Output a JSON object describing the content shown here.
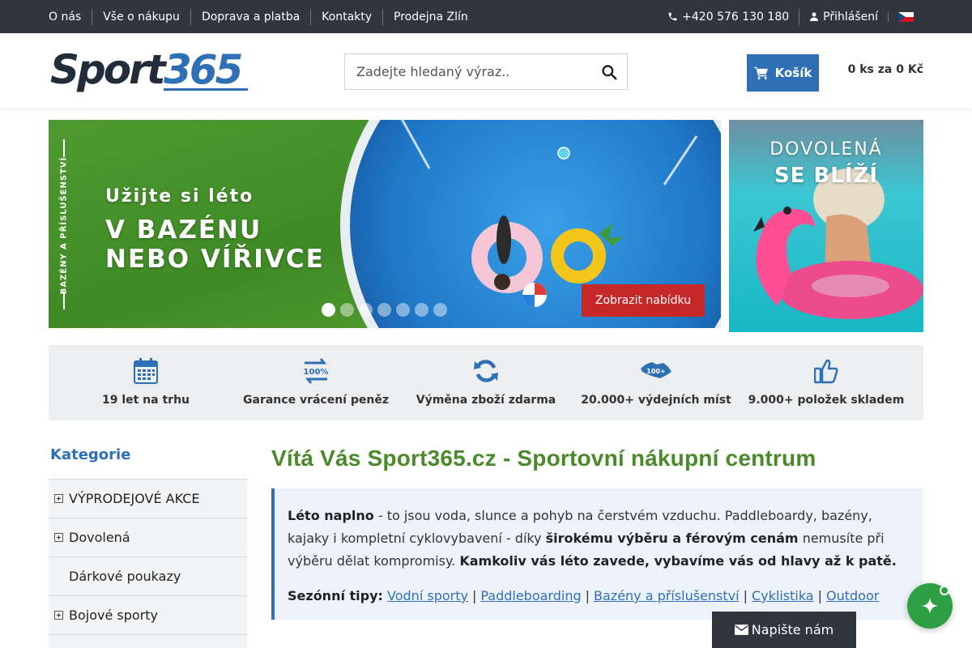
{
  "topbar": {
    "nav": [
      "O nás",
      "Vše o nákupu",
      "Doprava a platba",
      "Kontakty",
      "Prodejna Zlín"
    ],
    "phone": "+420 576 130 180",
    "login": "Přihlášení",
    "language": "cs-flag-icon"
  },
  "header": {
    "logo": {
      "part1": "Sport",
      "part2": "365"
    },
    "search_placeholder": "Zadejte hledaný výraz..",
    "search_value": "",
    "cart_label": "Košík",
    "cart_summary": "0 ks za 0 Kč"
  },
  "hero": {
    "side_label": "BAZÉNY A PŘÍSLUŠENSTVÍ",
    "line1": "Užijte si léto",
    "line2": "V BAZÉNU",
    "line3": "NEBO VÍŘIVCE",
    "cta": "Zobrazit nabídku",
    "slides_total": 7,
    "slide_active": 1
  },
  "promo": {
    "line1": "DOVOLENÁ",
    "line2": "SE BLÍŽÍ"
  },
  "usp": [
    {
      "icon": "calendar-icon",
      "label": "19 let na trhu"
    },
    {
      "icon": "money-back-icon",
      "label": "Garance vrácení peněz"
    },
    {
      "icon": "exchange-icon",
      "label": "Výměna zboží zdarma"
    },
    {
      "icon": "map-cz-icon",
      "label": "20.000+ výdejních míst"
    },
    {
      "icon": "thumbs-up-icon",
      "label": "9.000+ položek skladem"
    }
  ],
  "sidebar": {
    "title": "Kategorie",
    "items": [
      {
        "label": "VÝPRODEJOVÉ AKCE",
        "expandable": true
      },
      {
        "label": "Dovolená",
        "expandable": true
      },
      {
        "label": "Dárkové poukazy",
        "expandable": false
      },
      {
        "label": "Bojové sporty",
        "expandable": true
      }
    ]
  },
  "main": {
    "title": "Vítá Vás Sport365.cz - Sportovní nákupní centrum",
    "intro_b1": "Léto naplno",
    "intro_t1": " - to jsou voda, slunce a pohyb na čerstvém vzduchu. Paddleboardy, bazény, kajaky i kompletní cyklovybavení - díky ",
    "intro_b2": "širokému výběru a férovým cenám",
    "intro_t2": " nemusíte při výběru dělat kompromisy. ",
    "intro_b3": "Kamkoliv vás léto zavede, vybavíme vás od hlavy až k patě.",
    "tips_label": "Sezónní tipy:",
    "tips": [
      "Vodní sporty",
      "Paddleboarding",
      "Bazény a příslušenství",
      "Cyklistika",
      "Outdoor"
    ]
  },
  "chat": {
    "label": "Napište nám"
  },
  "colors": {
    "brand_blue": "#2f6fb5",
    "green": "#4b8a2b",
    "cta_red": "#c62828",
    "dark": "#2f3640"
  }
}
